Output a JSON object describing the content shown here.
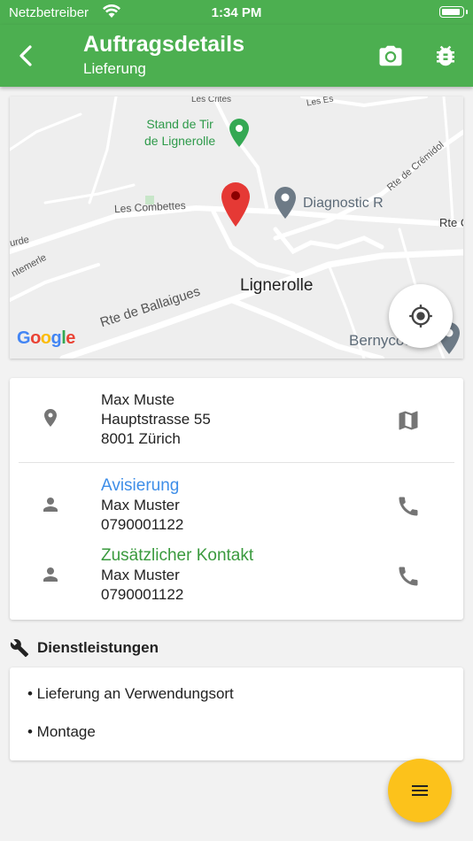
{
  "status_bar": {
    "carrier": "Netzbetreiber",
    "time": "1:34 PM",
    "battery_level": 0.95
  },
  "header": {
    "title": "Auftragsdetails",
    "subtitle": "Lieferung",
    "back_icon": "arrow-back-icon",
    "camera_icon": "camera-icon",
    "bug_icon": "bug-icon",
    "color": "#4caf50"
  },
  "map": {
    "labels": {
      "poi_green": "Stand de Tir\nde Lignerolle",
      "poi_diagnostic": "Diagnostic R",
      "town": "Lignerolle",
      "road_combettes": "Les Combettes",
      "road_ballaigues": "Rte de Ballaigues",
      "road_cremidol": "Rte de Crémidol",
      "road_rte_c": "Rte C",
      "road_crites": "Les Crites",
      "road_les_e": "Les Es",
      "road_urde": "urde",
      "road_ntemerle": "ntemerle",
      "poi_bernycourt": "Bernycou"
    },
    "logo": "Google",
    "locate_icon": "my-location-icon"
  },
  "address": {
    "name": "Max Muste",
    "street": "Hauptstrasse 55",
    "city": "8001 Zürich",
    "icon": "location-pin-icon",
    "map_icon": "map-icon"
  },
  "contacts": [
    {
      "label": "Avisierung",
      "name": "Max Muster",
      "phone": "0790001122",
      "label_color": "#3e8ee8"
    },
    {
      "label": "Zusätzlicher Kontakt",
      "name": "Max Muster",
      "phone": "0790001122",
      "label_color": "#3a9a3e"
    }
  ],
  "services": {
    "heading": "Dienstleistungen",
    "icon": "wrench-icon",
    "items": [
      "• Lieferung an Verwendungsort",
      "• Montage"
    ]
  },
  "fab": {
    "icon": "menu-icon",
    "color": "#fcc21b"
  }
}
